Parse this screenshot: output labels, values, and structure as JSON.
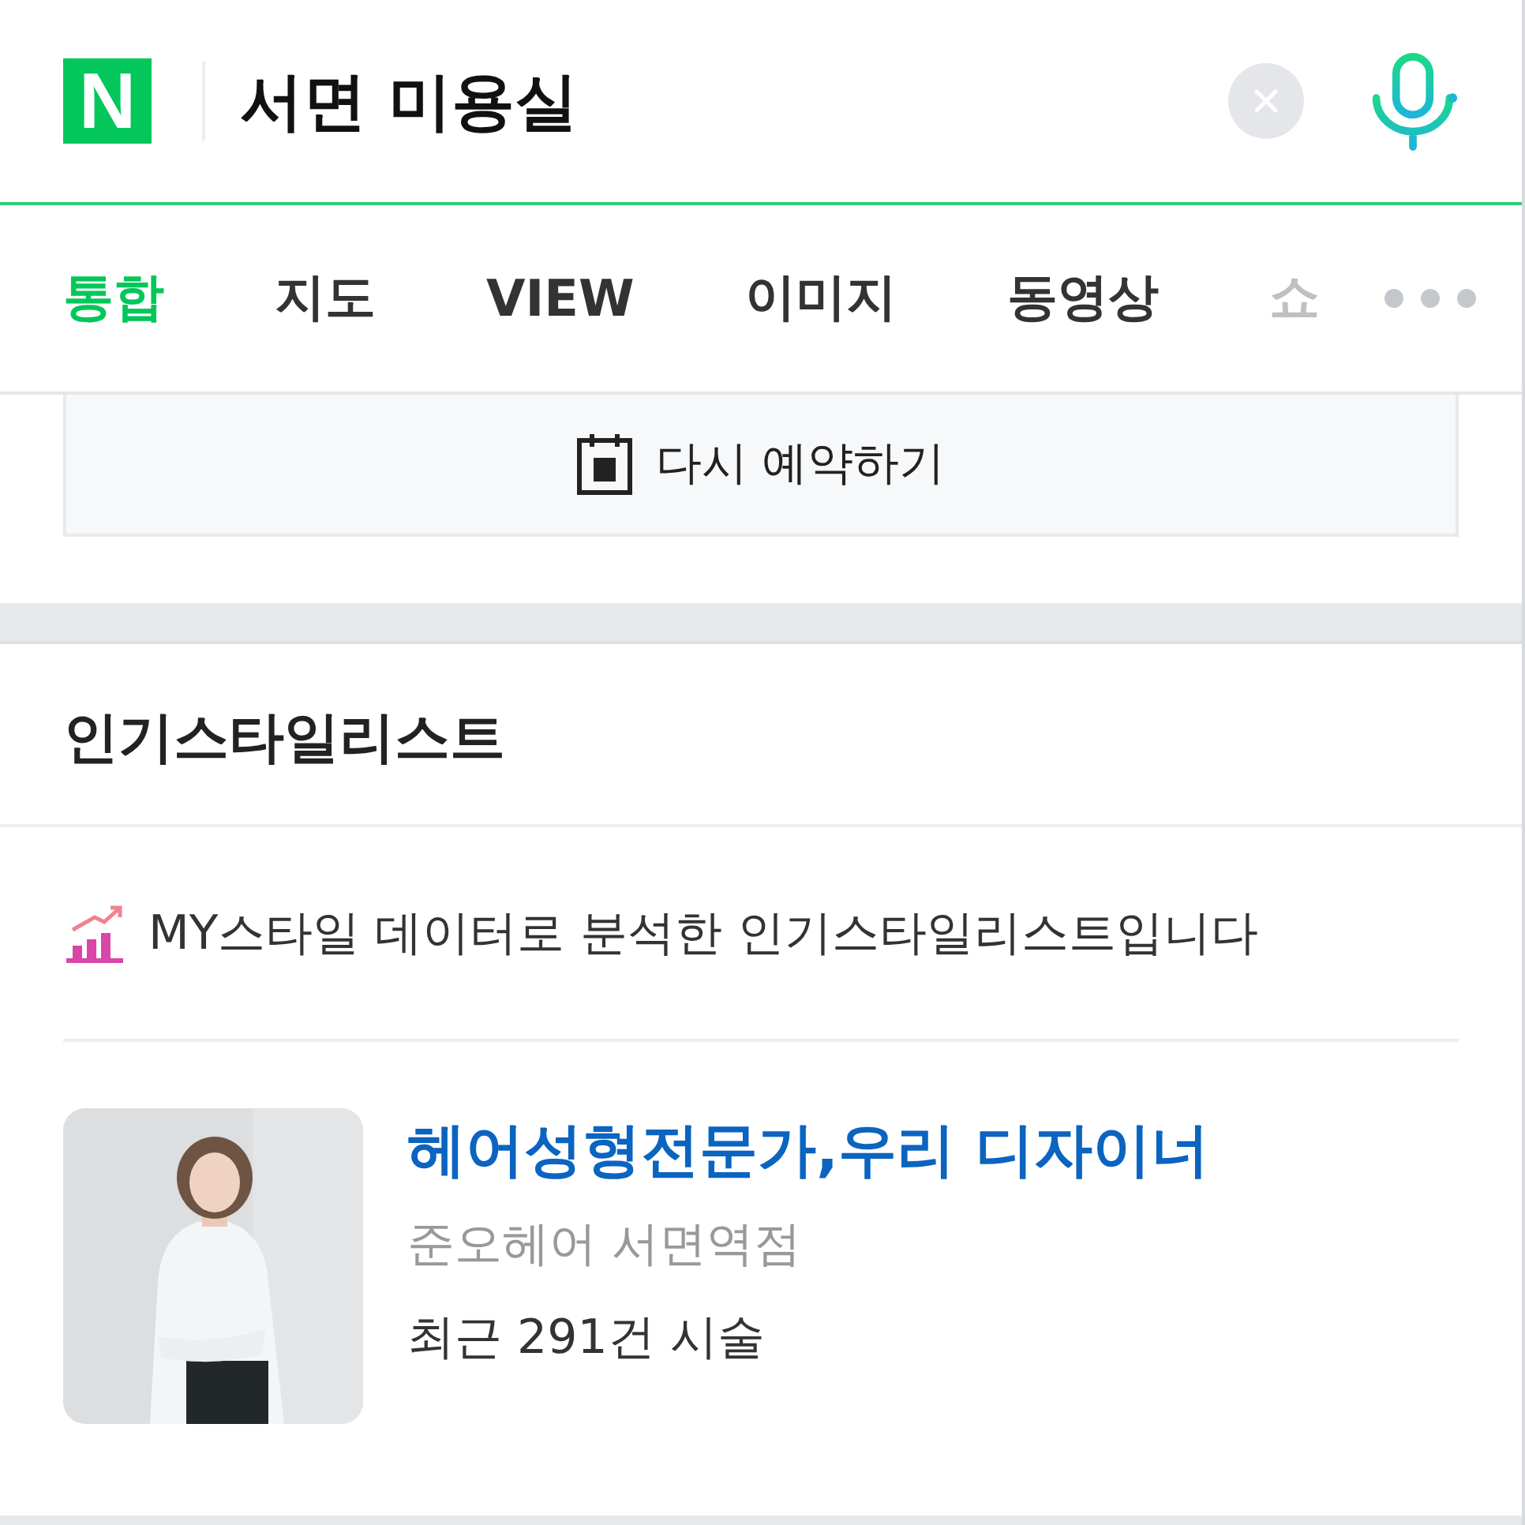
{
  "search": {
    "logo": "N",
    "query": "서면 미용실"
  },
  "tabs": [
    {
      "label": "통합",
      "selected": true,
      "faded": false
    },
    {
      "label": "지도",
      "selected": false,
      "faded": false
    },
    {
      "label": "VIEW",
      "selected": false,
      "faded": false
    },
    {
      "label": "이미지",
      "selected": false,
      "faded": false
    },
    {
      "label": "동영상",
      "selected": false,
      "faded": false
    },
    {
      "label": "쇼",
      "selected": false,
      "faded": true
    }
  ],
  "rebook_button": {
    "label": "다시 예약하기"
  },
  "section": {
    "title": "인기스타일리스트",
    "info": "MY스타일 데이터로 분석한 인기스타일리스트입니다",
    "stylists": [
      {
        "name": "헤어성형전문가,우리 디자이너",
        "shop": "준오헤어 서면역점",
        "count": "최근 291건 시술"
      }
    ]
  }
}
